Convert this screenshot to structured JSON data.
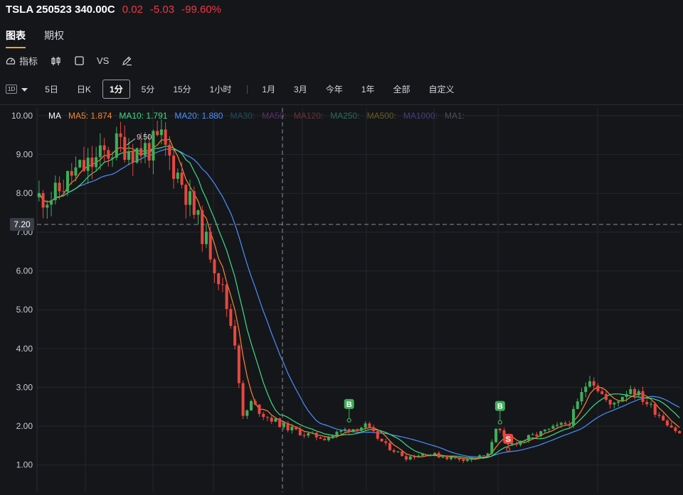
{
  "header": {
    "symbol": "TSLA 250523 340.00C",
    "price": "0.02",
    "change": "-5.03",
    "change_pct": "-99.60%",
    "down_color": "#f23645"
  },
  "tabs": [
    {
      "label": "图表",
      "active": true
    },
    {
      "label": "期权",
      "active": false
    }
  ],
  "tools": {
    "indicator_label": "指标",
    "vs_label": "VS",
    "icons": [
      "gauge-icon",
      "candlestick-icon",
      "square-icon",
      "pencil-icon"
    ]
  },
  "timeframe_selector": "1D",
  "periods": [
    "5日",
    "日K",
    "1分",
    "5分",
    "15分",
    "1小时",
    "1月",
    "3月",
    "今年",
    "1年",
    "全部",
    "自定义"
  ],
  "active_period": "1分",
  "chart_data": {
    "type": "candlestick",
    "y_ticks": [
      "10.00",
      "9.00",
      "8.00",
      "7.00",
      "6.00",
      "5.00",
      "4.00",
      "3.00",
      "2.00",
      "1.00"
    ],
    "ylim": [
      0.3,
      10.2
    ],
    "crosshair_value": "7.20",
    "crosshair_y": 7.2,
    "peak_label": "9.50",
    "peak_value": 9.5,
    "ma_legend": [
      {
        "text": "MA",
        "color": "#ffffff"
      },
      {
        "text": "MA5: 1.874",
        "color": "#f5862b"
      },
      {
        "text": "MA10: 1.791",
        "color": "#3ddc84"
      },
      {
        "text": "MA20: 1.880",
        "color": "#4a90ff"
      },
      {
        "text": "MA30:",
        "color": "#1f4e5c"
      },
      {
        "text": "MA50:",
        "color": "#5a2f6b"
      },
      {
        "text": "MA120:",
        "color": "#6b3232"
      },
      {
        "text": "MA250:",
        "color": "#2a6b55"
      },
      {
        "text": "MA500:",
        "color": "#6b5a20"
      },
      {
        "text": "MA1000:",
        "color": "#4a3b7a"
      },
      {
        "text": "MA1:",
        "color": "#4a4d55"
      }
    ],
    "price_path": [
      [
        0,
        7.9
      ],
      [
        4,
        7.95
      ],
      [
        8,
        8.5
      ],
      [
        12,
        8.7
      ],
      [
        16,
        9.0
      ],
      [
        20,
        9.3
      ],
      [
        24,
        9.1
      ],
      [
        28,
        9.2
      ],
      [
        30,
        9.35
      ],
      [
        32,
        8.9
      ],
      [
        35,
        8.3
      ],
      [
        38,
        7.5
      ],
      [
        42,
        6.5
      ],
      [
        45,
        5.5
      ],
      [
        48,
        4.2
      ],
      [
        50,
        2.2
      ],
      [
        52,
        2.6
      ],
      [
        55,
        2.3
      ],
      [
        60,
        2.0
      ],
      [
        65,
        1.8
      ],
      [
        70,
        1.7
      ],
      [
        75,
        1.9
      ],
      [
        80,
        2.0
      ],
      [
        85,
        1.5
      ],
      [
        90,
        1.2
      ],
      [
        95,
        1.3
      ],
      [
        100,
        1.2
      ],
      [
        105,
        1.15
      ],
      [
        110,
        1.25
      ],
      [
        112,
        2.0
      ],
      [
        115,
        1.5
      ],
      [
        120,
        1.7
      ],
      [
        125,
        1.9
      ],
      [
        130,
        2.1
      ],
      [
        135,
        3.3
      ],
      [
        140,
        2.5
      ],
      [
        145,
        3.0
      ],
      [
        150,
        2.5
      ],
      [
        157,
        1.8
      ]
    ],
    "markers": [
      {
        "label": "B",
        "idx": 76,
        "value": 2.15,
        "color": "#3fae5a"
      },
      {
        "label": "B",
        "idx": 113,
        "value": 2.1,
        "color": "#3fae5a"
      },
      {
        "label": "S",
        "idx": 115,
        "value": 1.4,
        "color": "#e8473f"
      }
    ],
    "up_color": "#3fae5a",
    "down_color": "#e8473f",
    "grid_color": "#24262c"
  }
}
